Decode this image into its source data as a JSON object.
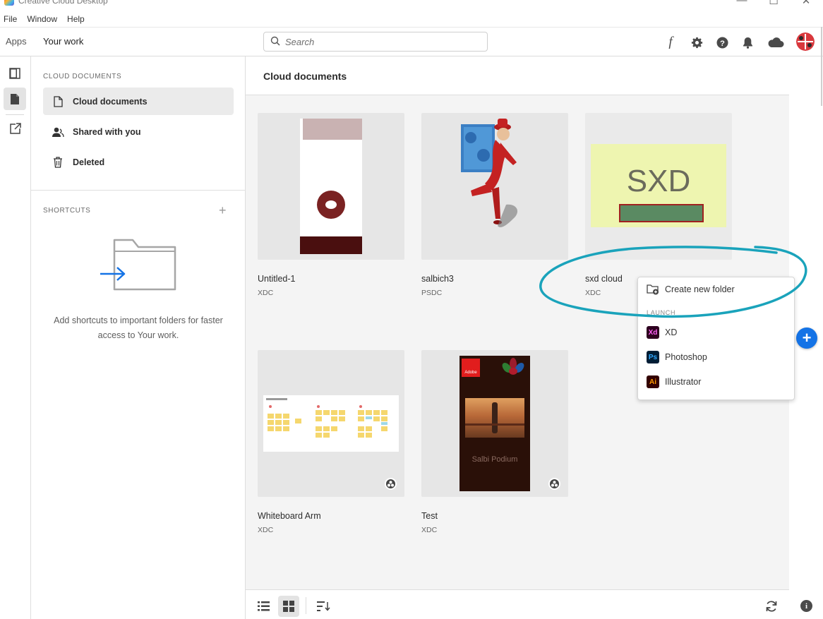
{
  "window": {
    "title": "Creative Cloud Desktop",
    "controls": [
      "—",
      "☐",
      "✕"
    ]
  },
  "menu": [
    "File",
    "Window",
    "Help"
  ],
  "topnav": {
    "tabs": [
      {
        "label": "Apps",
        "active": false
      },
      {
        "label": "Your work",
        "active": true
      }
    ],
    "search_placeholder": "Search",
    "icons": [
      "fonts-icon",
      "settings-gear-icon",
      "help-icon",
      "notifications-bell-icon",
      "cloud-icon",
      "avatar"
    ],
    "fonts_glyph": "f"
  },
  "sidebar": {
    "section_title": "CLOUD DOCUMENTS",
    "items": [
      {
        "label": "Cloud documents",
        "icon": "document-icon",
        "active": true
      },
      {
        "label": "Shared with you",
        "icon": "shared-users-icon",
        "active": false
      },
      {
        "label": "Deleted",
        "icon": "trash-icon",
        "active": false
      }
    ],
    "shortcuts_title": "SHORTCUTS",
    "shortcuts_add": "+",
    "empty_text": "Add shortcuts to important folders for faster access to Your work."
  },
  "main": {
    "title": "Cloud documents",
    "files": [
      {
        "name": "Untitled-1",
        "type": "XDC",
        "shared": false
      },
      {
        "name": "salbich3",
        "type": "PSDC",
        "shared": false
      },
      {
        "name": "sxd cloud",
        "type": "XDC",
        "shared": false,
        "thumb_text": "SXD"
      },
      {
        "name": "Whiteboard Arm",
        "type": "XDC",
        "shared": true
      },
      {
        "name": "Test",
        "type": "XDC",
        "shared": true,
        "thumb_text": "Salbi Podium",
        "adobe_label": "Adobe"
      }
    ]
  },
  "popup": {
    "create_folder": "Create new folder",
    "launch_title": "LAUNCH",
    "apps": [
      {
        "abbr": "Xd",
        "label": "XD",
        "bg": "#2e001f",
        "fg": "#ff61f6"
      },
      {
        "abbr": "Ps",
        "label": "Photoshop",
        "bg": "#001e36",
        "fg": "#31a8ff"
      },
      {
        "abbr": "Ai",
        "label": "Illustrator",
        "bg": "#330000",
        "fg": "#ff9a00"
      }
    ]
  },
  "fab": "+",
  "info": "i",
  "colors": {
    "accent": "#1473e6",
    "annotation": "#1aa3bb"
  }
}
